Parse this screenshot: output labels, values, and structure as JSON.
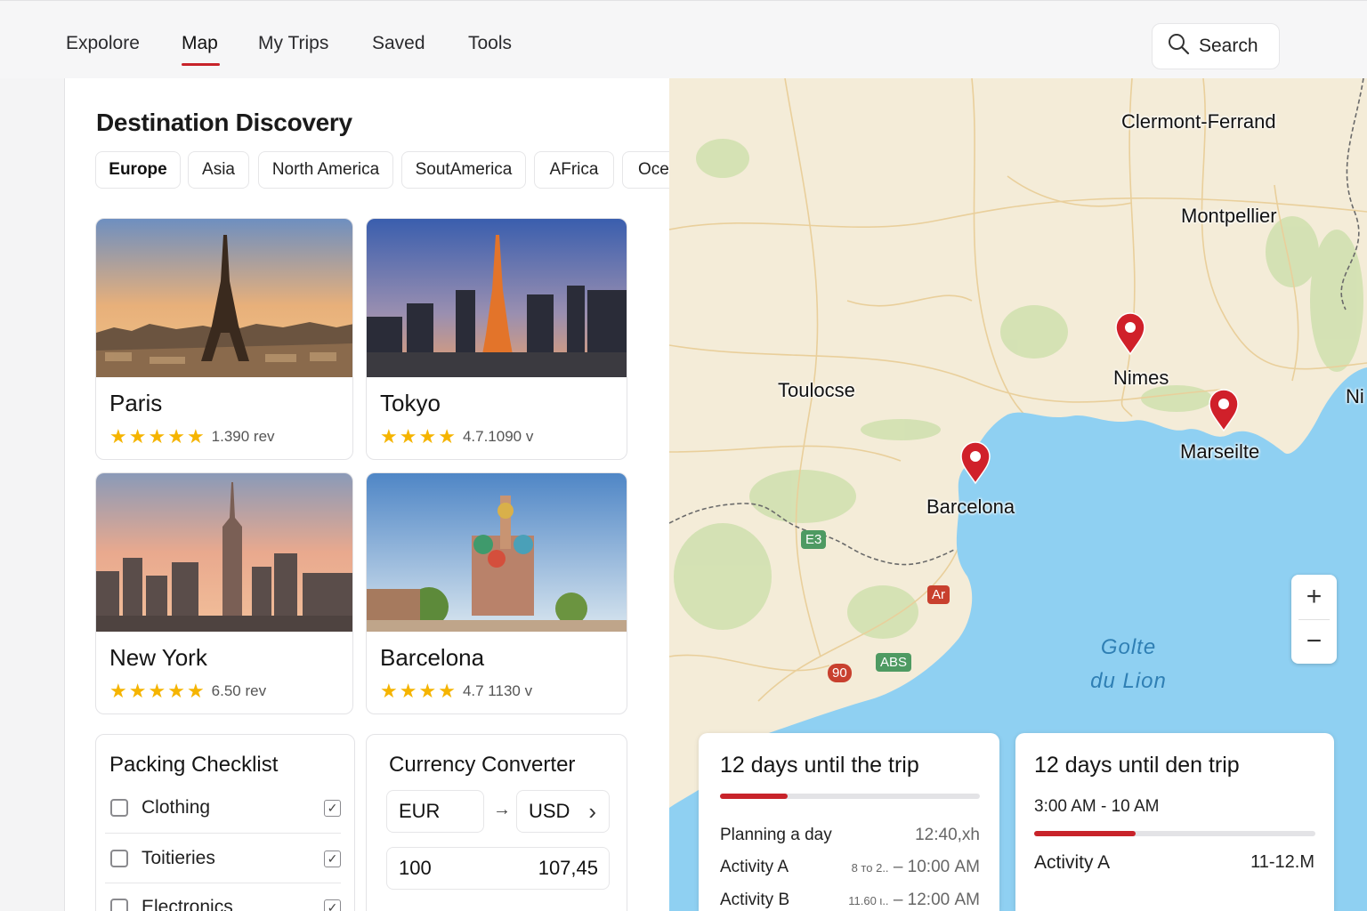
{
  "nav": {
    "tabs": [
      {
        "label": "Expolore"
      },
      {
        "label": "Map"
      },
      {
        "label": "My Trips"
      },
      {
        "label": "Saved"
      },
      {
        "label": "Tools"
      }
    ],
    "active_tab": "Map",
    "search_label": "Search",
    "accent_color": "#c8232a"
  },
  "discovery": {
    "title": "Destination Discovery",
    "regions": [
      "Europe",
      "Asia",
      "North America",
      "SoutAmerica",
      "AFrica",
      "Oce"
    ],
    "selected_region": "Europe",
    "destinations": [
      {
        "name": "Paris",
        "review": "1.390 rev",
        "stars": 4.5
      },
      {
        "name": "Tokyo",
        "review": "4.7.1090 v",
        "stars": 4
      },
      {
        "name": "New York",
        "review": "6.50 rev",
        "stars": 4.5
      },
      {
        "name": "Barcelona",
        "review": "4.7 1130 v",
        "stars": 4
      }
    ]
  },
  "packing": {
    "title": "Packing Checklist",
    "items": [
      {
        "label": "Clothing",
        "checked": true
      },
      {
        "label": "Toitieries",
        "checked": true
      },
      {
        "label": "Electronics",
        "checked": true
      }
    ],
    "check_glyph": "✓"
  },
  "currency": {
    "title": "Currency Converter",
    "from": "EUR",
    "to": "USD",
    "arrow": "→",
    "chevron": "›",
    "amount": "100",
    "result": "107,45"
  },
  "map": {
    "cities": [
      "Clermont-Ferrand",
      "Montpellier",
      "Toulocse",
      "Nimes",
      "Marseilte",
      "Barcelona",
      "Ni"
    ],
    "sea_label": [
      "Golte",
      "du Lion"
    ],
    "road_badges": [
      "E3",
      "Ar",
      "ABS",
      "90"
    ],
    "zoom_in": "+",
    "zoom_out": "−",
    "pins": [
      "Nimes",
      "Marseilte",
      "Barcelona"
    ]
  },
  "trip_cards": [
    {
      "title": "12 days until the trip",
      "progress": 0.26,
      "rows": [
        {
          "label": "Planning a day",
          "prefix": "",
          "value": "12:40,xh"
        },
        {
          "label": "Activity A",
          "prefix": "8 то 2..",
          "value": "– 10:00 AM"
        },
        {
          "label": "Activity B",
          "prefix": "11.60 ι..",
          "value": "– 12:00 AM"
        }
      ]
    },
    {
      "title": "12 days until den trip",
      "time": "3:00 AM - 10 AM",
      "progress": 0.36,
      "rows": [
        {
          "label": "Activity A",
          "value": "11-12.M"
        }
      ]
    }
  ]
}
